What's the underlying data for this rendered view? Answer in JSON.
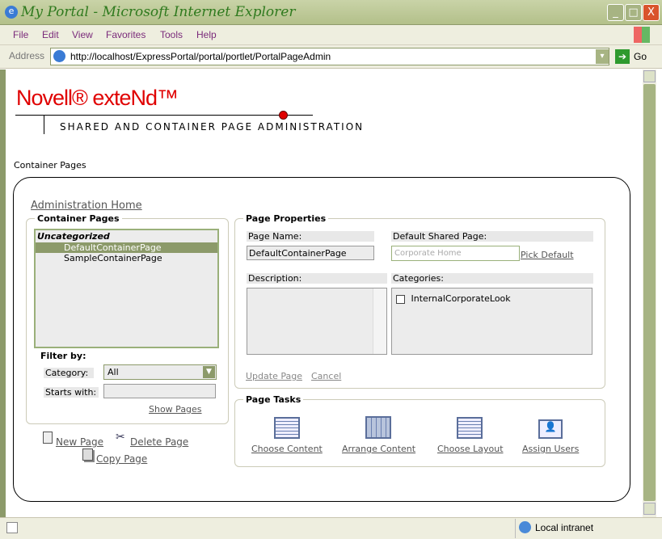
{
  "window": {
    "title": "My Portal - Microsoft Internet Explorer",
    "minimize": "_",
    "maximize": "□",
    "close": "X"
  },
  "menu": [
    "File",
    "Edit",
    "View",
    "Favorites",
    "Tools",
    "Help"
  ],
  "address": {
    "label": "Address",
    "url": "http://localhost/ExpressPortal/portal/portlet/PortalPageAdmin",
    "go": "Go"
  },
  "header": {
    "logo": "Novell® exteNd™",
    "subtitle": "SHARED AND CONTAINER PAGE ADMINISTRATION"
  },
  "breadcrumb": "Container Pages",
  "admin_home": "Administration Home",
  "container_pages": {
    "legend": "Container Pages",
    "category": "Uncategorized",
    "items": [
      "DefaultContainerPage",
      "SampleContainerPage"
    ],
    "selected": "DefaultContainerPage"
  },
  "filter": {
    "title": "Filter by:",
    "category_label": "Category:",
    "category_value": "All",
    "starts_label": "Starts with:",
    "starts_value": "",
    "show": "Show Pages"
  },
  "actions": {
    "new": "New Page",
    "delete": "Delete Page",
    "copy": "Copy Page"
  },
  "properties": {
    "legend": "Page Properties",
    "name_label": "Page Name:",
    "name_value": "DefaultContainerPage",
    "shared_label": "Default Shared Page:",
    "shared_placeholder": "Corporate Home",
    "pick": "Pick Default",
    "desc_label": "Description:",
    "cat_label": "Categories:",
    "categories": [
      "InternalCorporateLook"
    ],
    "update": "Update Page",
    "cancel": "Cancel"
  },
  "tasks": {
    "legend": "Page Tasks",
    "items": [
      "Choose Content",
      "Arrange Content",
      "Choose Layout",
      "Assign Users"
    ]
  },
  "status": {
    "zone": "Local intranet"
  },
  "colors": {
    "accent": "#8c9a6a",
    "brand_red": "#e00000"
  }
}
